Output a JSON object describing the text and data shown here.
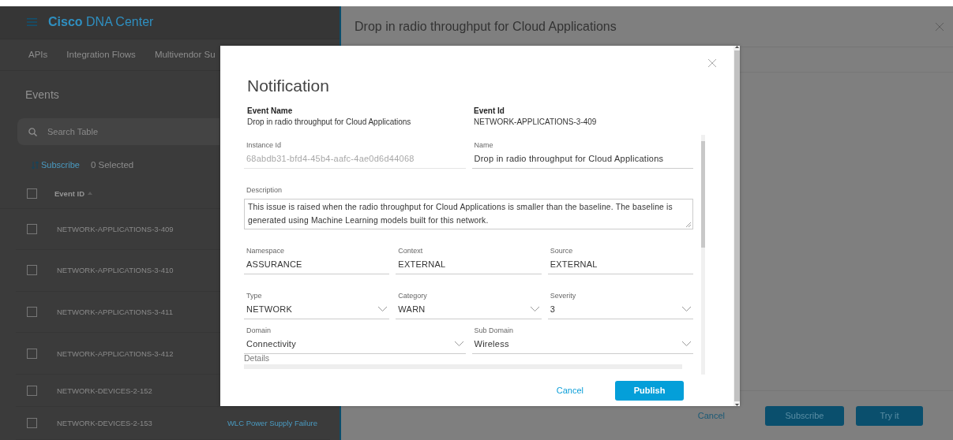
{
  "app": {
    "brand_bold": "Cisco",
    "brand": "DNA Center",
    "nav": [
      "APIs",
      "Integration Flows",
      "Multivendor Su"
    ],
    "section_title": "Events",
    "search": {
      "placeholder": "Search Table"
    },
    "toolbar": {
      "subscribe": "Subscribe",
      "selected_count": "0 Selected"
    },
    "table": {
      "columns": [
        {
          "label": "Event ID",
          "sorted": true
        }
      ],
      "header_checked": false,
      "rows": [
        {
          "event_id": "NETWORK-APPLICATIONS-3-409",
          "checked": false
        },
        {
          "event_id": "NETWORK-APPLICATIONS-3-410",
          "checked": false
        },
        {
          "event_id": "NETWORK-APPLICATIONS-3-411",
          "checked": false
        },
        {
          "event_id": "NETWORK-APPLICATIONS-3-412",
          "checked": false
        },
        {
          "event_id": "NETWORK-DEVICES-2-152",
          "checked": false
        },
        {
          "event_id": "NETWORK-DEVICES-2-153",
          "checked": false,
          "column_2": "WLC Power Supply Failure"
        }
      ]
    }
  },
  "panel": {
    "title": "Drop in radio throughput for Cloud Applications",
    "cancel": "Cancel",
    "buttons": [
      "Subscribe",
      "Try it"
    ]
  },
  "modal": {
    "title": "Notification",
    "summary": [
      {
        "label": "Event Name",
        "value": "Drop in radio throughput for Cloud Applications"
      },
      {
        "label": "Event Id",
        "value": "NETWORK-APPLICATIONS-3-409"
      }
    ],
    "field_rows": [
      [
        {
          "kind": "text",
          "label": "Instance Id",
          "value": "68abdb31-bfd4-45b4-aafc-4ae0d6d44068",
          "disabled": true
        },
        {
          "kind": "text",
          "label": "Name",
          "value": "Drop in radio throughput for Cloud Applications",
          "disabled": false
        }
      ],
      [
        {
          "kind": "textarea",
          "label": "Description",
          "value": "This issue is raised when the radio throughput for Cloud Applications is smaller than the baseline. The baseline is generated using Machine Learning models built for this network.",
          "disabled": false
        }
      ],
      [
        {
          "kind": "text",
          "label": "Namespace",
          "value": "ASSURANCE",
          "disabled": false
        },
        {
          "kind": "text",
          "label": "Context",
          "value": "EXTERNAL",
          "disabled": false
        },
        {
          "kind": "text",
          "label": "Source",
          "value": "EXTERNAL",
          "disabled": false
        }
      ],
      [
        {
          "kind": "select",
          "label": "Type",
          "value": "NETWORK",
          "disabled": false
        },
        {
          "kind": "select",
          "label": "Category",
          "value": "WARN",
          "disabled": false
        },
        {
          "kind": "select",
          "label": "Severity",
          "value": "3",
          "disabled": false
        }
      ],
      [
        {
          "kind": "select",
          "label": "Domain",
          "value": "Connectivity",
          "disabled": false
        },
        {
          "kind": "select",
          "label": "Sub Domain",
          "value": "Wireless",
          "disabled": false
        }
      ]
    ],
    "details_label": "Details",
    "cancel": "Cancel",
    "publish": "Publish"
  }
}
